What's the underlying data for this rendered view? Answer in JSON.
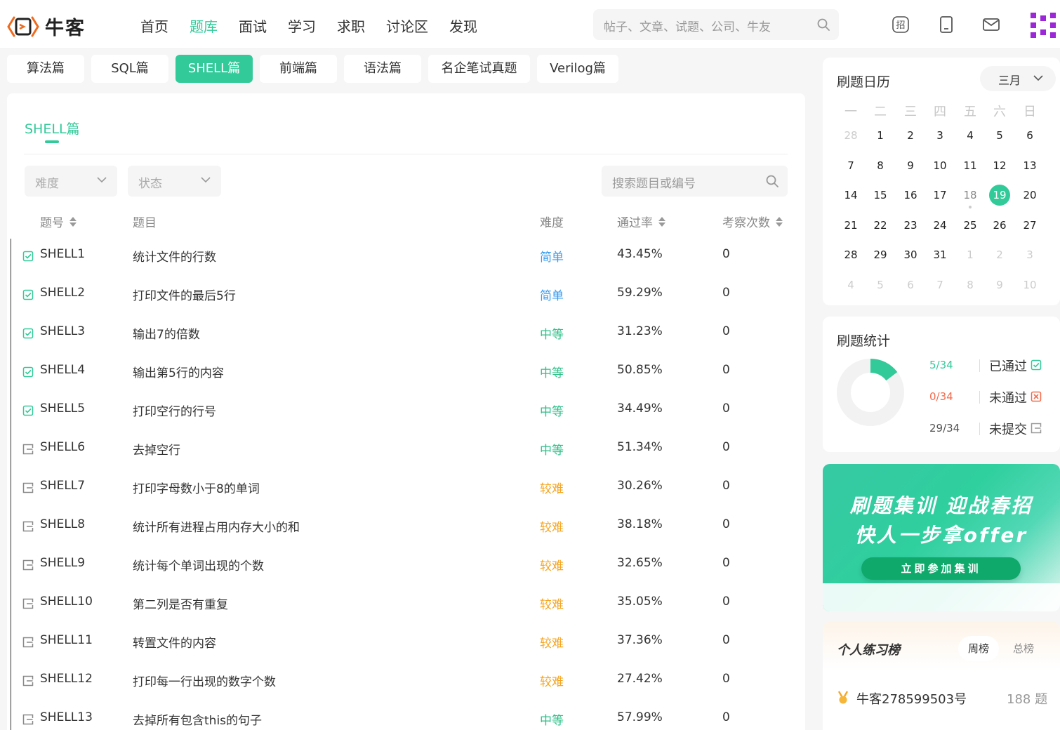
{
  "header": {
    "logo_text": "牛客",
    "nav": [
      "首页",
      "题库",
      "面试",
      "学习",
      "求职",
      "讨论区",
      "发现"
    ],
    "nav_active": 1,
    "search_placeholder": "帖子、文章、试题、公司、牛友",
    "icons": [
      "recruit-icon",
      "mobile-icon",
      "mail-icon",
      "avatar-icon"
    ],
    "recruit_icon_label": "招"
  },
  "pills": [
    "算法篇",
    "SQL篇",
    "SHELL篇",
    "前端篇",
    "语法篇",
    "名企笔试真题",
    "Verilog篇"
  ],
  "pills_active": 2,
  "panel": {
    "title": "SHELL篇",
    "filter_difficulty": "难度",
    "filter_status": "状态",
    "search_placeholder": "搜索题目或编号",
    "columns": {
      "id": "题号",
      "title": "题目",
      "difficulty": "难度",
      "rate": "通过率",
      "count": "考察次数"
    }
  },
  "rows": [
    {
      "status": "passed",
      "id": "SHELL1",
      "title": "统计文件的行数",
      "difficulty": "简单",
      "level": "easy",
      "rate": "43.45%",
      "count": "0"
    },
    {
      "status": "passed",
      "id": "SHELL2",
      "title": "打印文件的最后5行",
      "difficulty": "简单",
      "level": "easy",
      "rate": "59.29%",
      "count": "0"
    },
    {
      "status": "passed",
      "id": "SHELL3",
      "title": "输出7的倍数",
      "difficulty": "中等",
      "level": "medium",
      "rate": "31.23%",
      "count": "0"
    },
    {
      "status": "passed",
      "id": "SHELL4",
      "title": "输出第5行的内容",
      "difficulty": "中等",
      "level": "medium",
      "rate": "50.85%",
      "count": "0"
    },
    {
      "status": "passed",
      "id": "SHELL5",
      "title": "打印空行的行号",
      "difficulty": "中等",
      "level": "medium",
      "rate": "34.49%",
      "count": "0"
    },
    {
      "status": "none",
      "id": "SHELL6",
      "title": "去掉空行",
      "difficulty": "中等",
      "level": "medium",
      "rate": "51.34%",
      "count": "0"
    },
    {
      "status": "none",
      "id": "SHELL7",
      "title": "打印字母数小于8的单词",
      "difficulty": "较难",
      "level": "hard",
      "rate": "30.26%",
      "count": "0"
    },
    {
      "status": "none",
      "id": "SHELL8",
      "title": "统计所有进程占用内存大小的和",
      "difficulty": "较难",
      "level": "hard",
      "rate": "38.18%",
      "count": "0"
    },
    {
      "status": "none",
      "id": "SHELL9",
      "title": "统计每个单词出现的个数",
      "difficulty": "较难",
      "level": "hard",
      "rate": "32.65%",
      "count": "0"
    },
    {
      "status": "none",
      "id": "SHELL10",
      "title": "第二列是否有重复",
      "difficulty": "较难",
      "level": "hard",
      "rate": "35.05%",
      "count": "0"
    },
    {
      "status": "none",
      "id": "SHELL11",
      "title": "转置文件的内容",
      "difficulty": "较难",
      "level": "hard",
      "rate": "37.36%",
      "count": "0"
    },
    {
      "status": "none",
      "id": "SHELL12",
      "title": "打印每一行出现的数字个数",
      "difficulty": "较难",
      "level": "hard",
      "rate": "27.42%",
      "count": "0"
    },
    {
      "status": "none",
      "id": "SHELL13",
      "title": "去掉所有包含this的句子",
      "difficulty": "中等",
      "level": "medium",
      "rate": "57.99%",
      "count": "0"
    }
  ],
  "calendar": {
    "title": "刷题日历",
    "month": "三月",
    "weekdays": [
      "一",
      "二",
      "三",
      "四",
      "五",
      "六",
      "日"
    ],
    "weeks": [
      [
        "28",
        "1",
        "2",
        "3",
        "4",
        "5",
        "6"
      ],
      [
        "7",
        "8",
        "9",
        "10",
        "11",
        "12",
        "13"
      ],
      [
        "14",
        "15",
        "16",
        "17",
        "18",
        "19",
        "20"
      ],
      [
        "21",
        "22",
        "23",
        "24",
        "25",
        "26",
        "27"
      ],
      [
        "28",
        "29",
        "30",
        "31",
        "1",
        "2",
        "3"
      ],
      [
        "4",
        "5",
        "6",
        "7",
        "8",
        "9",
        "10"
      ]
    ],
    "today": "19"
  },
  "stats": {
    "title": "刷题统计",
    "passed": "5/34",
    "passed_label": "已通过",
    "failed": "0/34",
    "failed_label": "未通过",
    "unsubmitted": "29/34",
    "unsubmitted_label": "未提交",
    "passed_fraction": 0.147
  },
  "banner": {
    "line1": "刷题集训 迎战春招",
    "line2": "快人一步拿offer",
    "button": "立即参加集训"
  },
  "rank": {
    "title": "个人练习榜",
    "tab_week": "周榜",
    "tab_total": "总榜",
    "user": "牛客278599503号",
    "score": "188 题"
  },
  "colors": {
    "accent": "#32ca99",
    "easy": "#3a9bf0",
    "medium": "#2fc08a",
    "hard": "#f5a623",
    "fail": "#f36b4c"
  }
}
